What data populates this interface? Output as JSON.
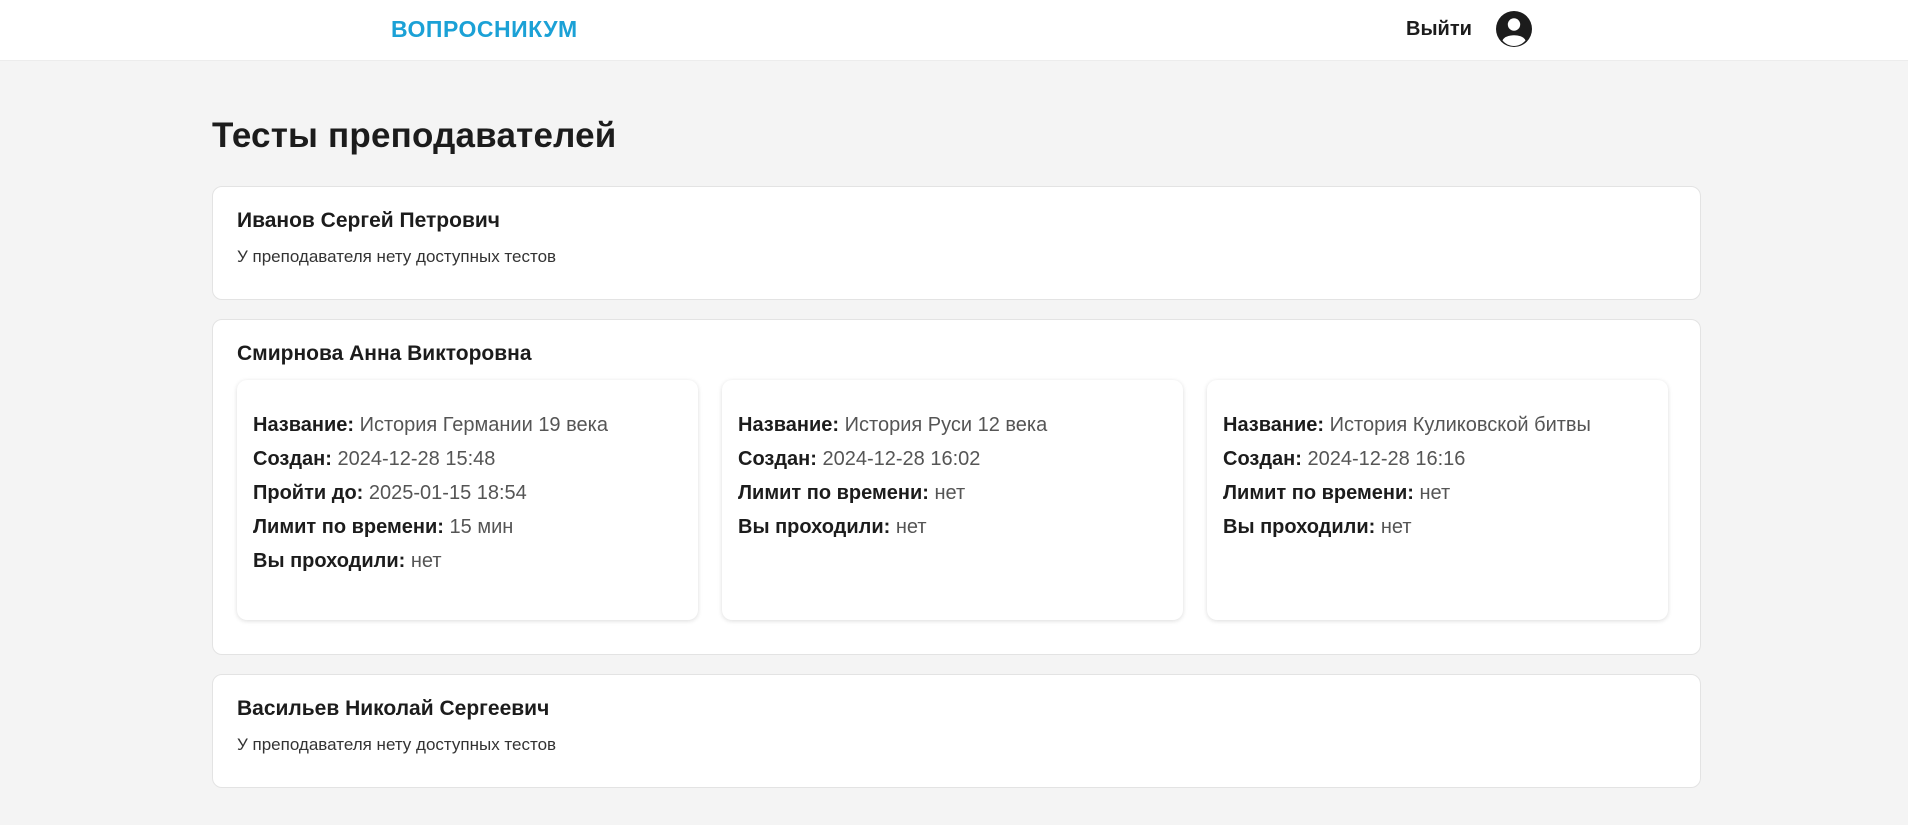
{
  "header": {
    "logo": "ВОПРОСНИКУМ",
    "logout_label": "Выйти",
    "avatar_icon": "user-circle-icon"
  },
  "page": {
    "title": "Тесты преподавателей"
  },
  "colors": {
    "brand": "#1ba1d6",
    "background": "#f4f4f4"
  },
  "teachers": [
    {
      "name": "Иванов Сергей Петрович",
      "empty_text": "У преподавателя нету доступных тестов",
      "tests": []
    },
    {
      "name": "Смирнова Анна Викторовна",
      "tests": [
        {
          "title_label": "Название:",
          "title": "История Германии 19 века",
          "created_label": "Создан:",
          "created": "2024-12-28 15:48",
          "due_label": "Пройти до:",
          "due": "2025-01-15 18:54",
          "time_limit_label": "Лимит по времени:",
          "time_limit": "15 мин",
          "taken_label": "Вы проходили:",
          "taken": "нет"
        },
        {
          "title_label": "Название:",
          "title": "История Руси 12 века",
          "created_label": "Создан:",
          "created": "2024-12-28 16:02",
          "time_limit_label": "Лимит по времени:",
          "time_limit": "нет",
          "taken_label": "Вы проходили:",
          "taken": "нет"
        },
        {
          "title_label": "Название:",
          "title": "История Куликовской битвы",
          "created_label": "Создан:",
          "created": "2024-12-28 16:16",
          "time_limit_label": "Лимит по времени:",
          "time_limit": "нет",
          "taken_label": "Вы проходили:",
          "taken": "нет"
        }
      ]
    },
    {
      "name": "Васильев Николай Сергеевич",
      "empty_text": "У преподавателя нету доступных тестов",
      "tests": []
    }
  ]
}
